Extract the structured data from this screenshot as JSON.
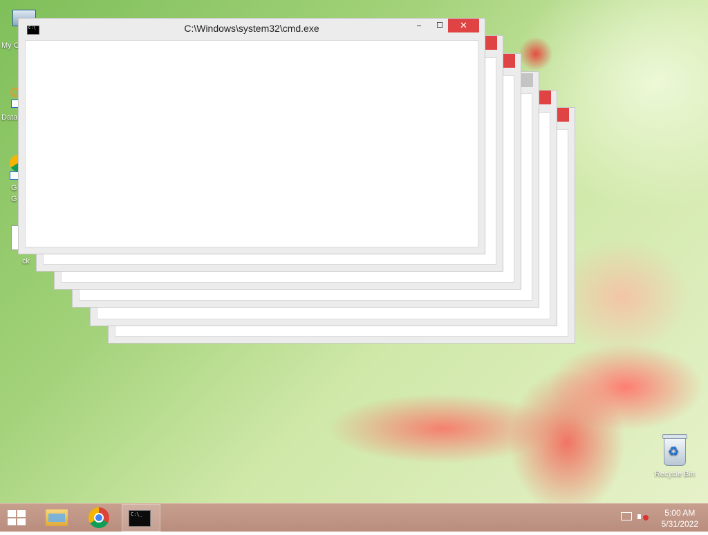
{
  "window": {
    "title": "C:\\Windows\\system32\\cmd.exe",
    "minimize_glyph": "‒",
    "maximize_glyph": "☐",
    "close_glyph": "✕"
  },
  "desktop": {
    "left_edge_labels": [
      "My C",
      "Data",
      "G",
      "G",
      "ck"
    ],
    "recycle_bin_label": "Recycle Bin",
    "colors": {
      "accent_close": "#e04343",
      "taskbar": "#c39a8a"
    }
  },
  "taskbar": {
    "apps": [
      "start-button",
      "file-explorer",
      "google-chrome",
      "command-prompt"
    ],
    "clock": {
      "time": "5:00 AM",
      "date": "5/31/2022"
    },
    "tray_icons": [
      "network-icon",
      "volume-muted-icon"
    ]
  }
}
